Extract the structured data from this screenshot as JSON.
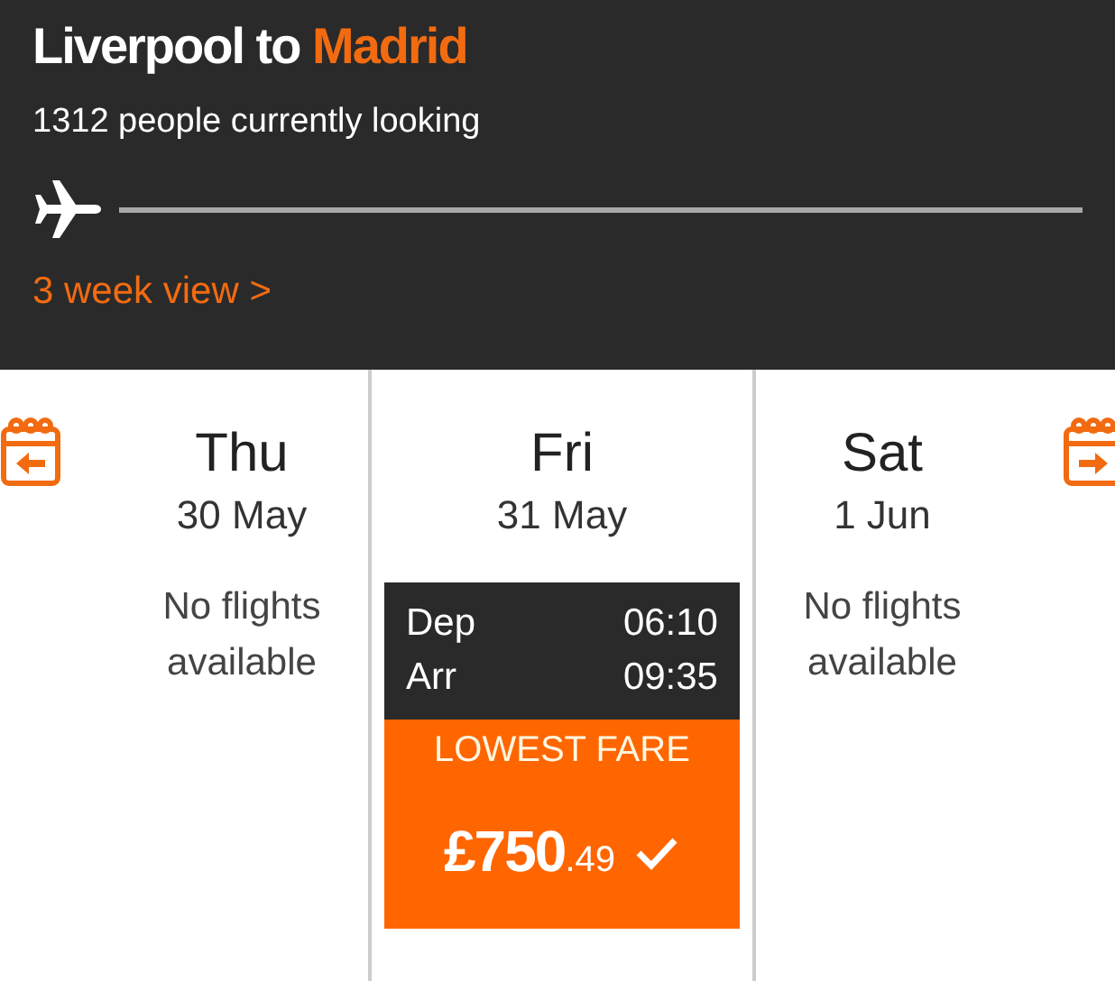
{
  "header": {
    "route": {
      "origin_text": "Liverpool to",
      "destination": "Madrid"
    },
    "watchers": "1312 people currently looking",
    "week_view_link": "3 week view >"
  },
  "days": [
    {
      "kind": "no_flights",
      "day": "Thu",
      "date": "30 May",
      "message": "No flights available"
    },
    {
      "kind": "flight",
      "day": "Fri",
      "date": "31 May",
      "dep_label": "Dep",
      "dep_time": "06:10",
      "arr_label": "Arr",
      "arr_time": "09:35",
      "badge": "LOWEST FARE",
      "price_main": "£750",
      "price_pence": ".49",
      "selected": true
    },
    {
      "kind": "no_flights",
      "day": "Sat",
      "date": "1 Jun",
      "message": "No flights available"
    }
  ]
}
